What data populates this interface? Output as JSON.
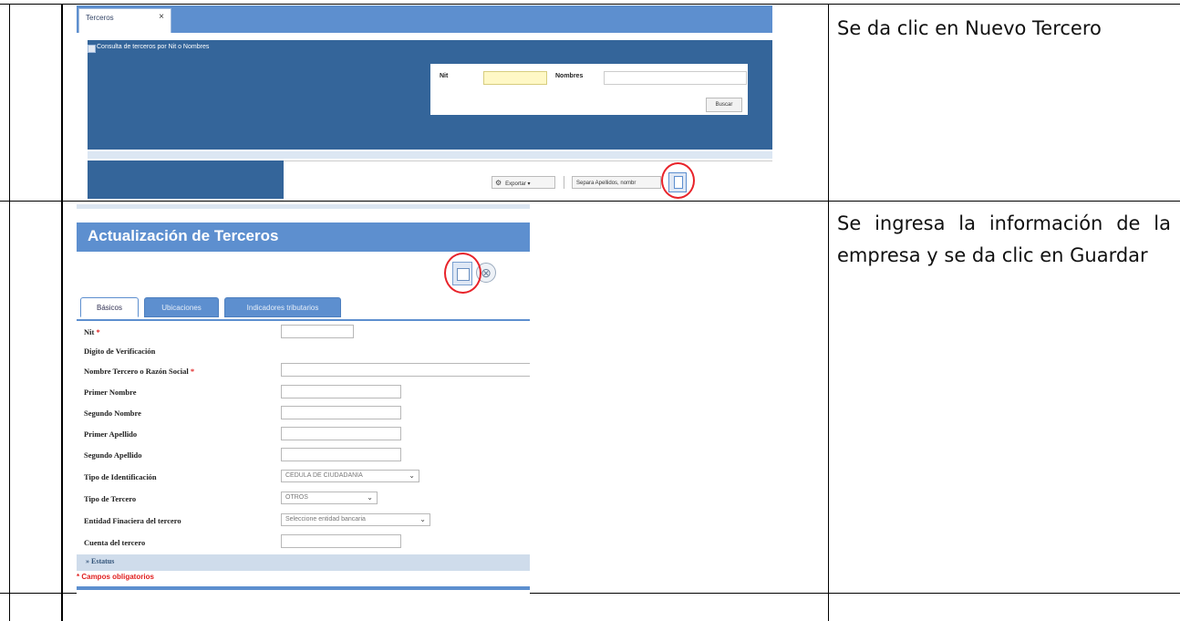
{
  "steps": [
    {
      "text": "Se da clic en Nuevo Tercero"
    },
    {
      "text": "Se ingresa la información de la empresa y se da clic en Guardar"
    }
  ],
  "shot1": {
    "tab_label": "Terceros",
    "tab_close": "×",
    "panel_title": "Consulta de terceros por Nit o Nombres",
    "nit_label": "Nit",
    "nombres_label": "Nombres",
    "buscar_label": "Buscar",
    "exportar_label": "Exportar ▾",
    "separar_label": "Separa Apellidos, nombr"
  },
  "shot2": {
    "title": "Actualización de Terceros",
    "tabs": [
      {
        "label": "Básicos",
        "active": true
      },
      {
        "label": "Ubicaciones",
        "active": false
      },
      {
        "label": "Indicadores tributarios",
        "active": false
      }
    ],
    "fields": {
      "nit": "Nit",
      "digito": "Digito de Verificación",
      "nombre_razon": "Nombre Tercero o Razón Social",
      "primer_nombre": "Primer Nombre",
      "segundo_nombre": "Segundo Nombre",
      "primer_apellido": "Primer Apellido",
      "segundo_apellido": "Segundo Apellido",
      "tipo_identificacion": "Tipo de Identificación",
      "tipo_tercero": "Tipo de Tercero",
      "entidad_financiera": "Entidad Finaciera del tercero",
      "cuenta": "Cuenta del tercero"
    },
    "required_mark": "*",
    "selects": {
      "tipo_identificacion": "CEDULA DE CIUDADANIA",
      "tipo_tercero": "OTROS",
      "entidad_financiera": "Seleccione entidad bancaria"
    },
    "estatus_label": "» Estatus",
    "campos_obligatorios": "* Campos obligatorios"
  },
  "colors": {
    "header_blue": "#5d8fcf",
    "panel_blue": "#34659a",
    "annotation_red": "#e8232a"
  }
}
